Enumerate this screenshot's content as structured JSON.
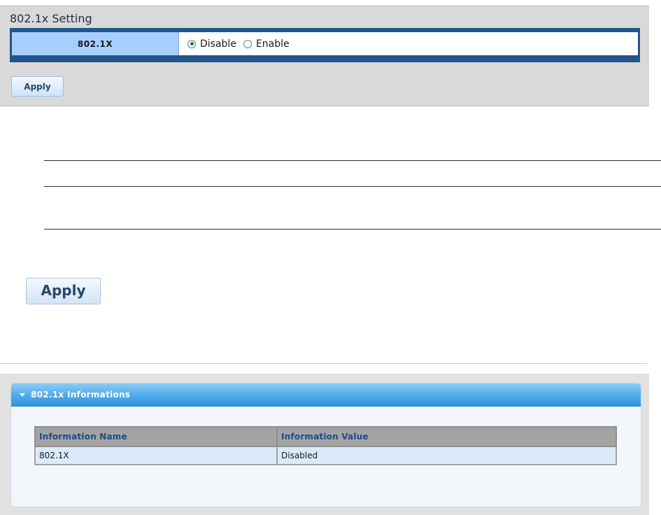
{
  "setting": {
    "title": "802.1x Setting",
    "row_label": "802.1X",
    "options": [
      {
        "label": "Disable",
        "checked": true
      },
      {
        "label": "Enable",
        "checked": false
      }
    ],
    "apply_label": "Apply"
  },
  "middle": {
    "apply_label": "Apply"
  },
  "info": {
    "title": "802.1x Informations",
    "columns": [
      "Information Name",
      "Information Value"
    ],
    "rows": [
      [
        "802.1X",
        "Disabled"
      ]
    ]
  },
  "colors": {
    "setting_label_bg": "#a8ceff",
    "setting_border": "#21558c",
    "info_header": "#4eaaea",
    "selected_radio": "#2e7d1e"
  }
}
